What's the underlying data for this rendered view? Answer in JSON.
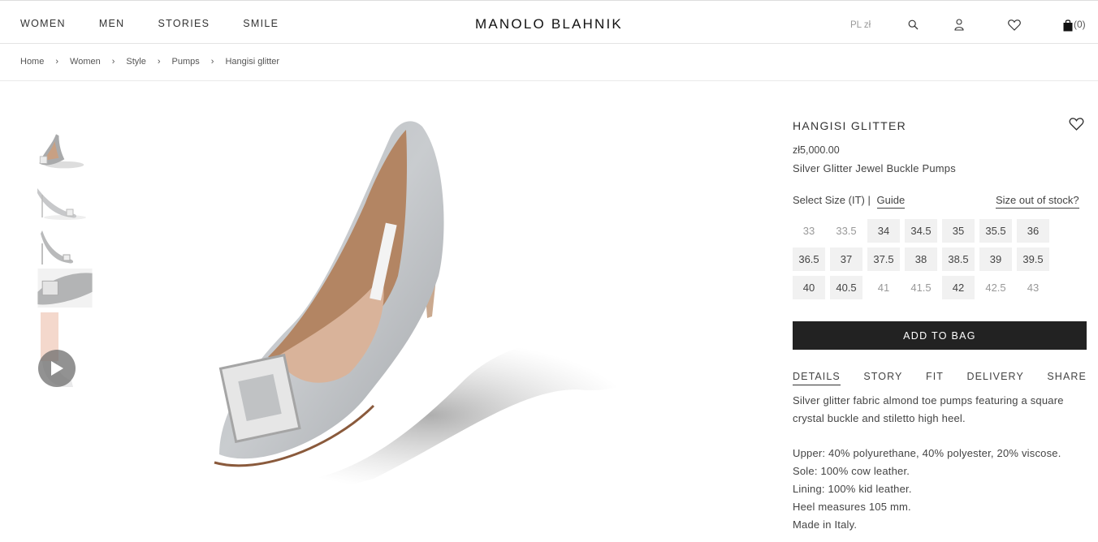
{
  "nav": {
    "items": [
      "WOMEN",
      "MEN",
      "STORIES",
      "SMILE"
    ]
  },
  "brand": "MANOLO BLAHNIK",
  "header": {
    "currency": "PL zł",
    "bag_count": "(0)"
  },
  "breadcrumb": [
    "Home",
    "Women",
    "Style",
    "Pumps",
    "Hangisi glitter"
  ],
  "product": {
    "title": "HANGISI GLITTER",
    "price": "zł5,000.00",
    "subtitle": "Silver Glitter Jewel Buckle Pumps",
    "select_size_label": "Select Size (IT)",
    "guide_label": "Guide",
    "out_of_stock_label": "Size out of stock?",
    "add_to_bag": "ADD TO BAG",
    "sizes": [
      {
        "label": "33",
        "available": false
      },
      {
        "label": "33.5",
        "available": false
      },
      {
        "label": "34",
        "available": true
      },
      {
        "label": "34.5",
        "available": true
      },
      {
        "label": "35",
        "available": true
      },
      {
        "label": "35.5",
        "available": true
      },
      {
        "label": "36",
        "available": true
      },
      {
        "label": "36.5",
        "available": true
      },
      {
        "label": "37",
        "available": true
      },
      {
        "label": "37.5",
        "available": true
      },
      {
        "label": "38",
        "available": true
      },
      {
        "label": "38.5",
        "available": true
      },
      {
        "label": "39",
        "available": true
      },
      {
        "label": "39.5",
        "available": true
      },
      {
        "label": "40",
        "available": true
      },
      {
        "label": "40.5",
        "available": true
      },
      {
        "label": "41",
        "available": false
      },
      {
        "label": "41.5",
        "available": false
      },
      {
        "label": "42",
        "available": true
      },
      {
        "label": "42.5",
        "available": false
      },
      {
        "label": "43",
        "available": false
      }
    ],
    "tabs": [
      "DETAILS",
      "STORY",
      "FIT",
      "DELIVERY",
      "SHARE"
    ],
    "description": "Silver glitter fabric almond toe pumps featuring a square crystal buckle and stiletto high heel.",
    "specs": [
      "Upper: 40% polyurethane, 40% polyester, 20% viscose.",
      "Sole: 100% cow leather.",
      "Lining: 100% kid leather.",
      "Heel measures 105 mm.",
      "Made in Italy."
    ]
  },
  "icons": {
    "search": "search-icon",
    "account": "user-icon",
    "wishlist": "heart-icon",
    "bag": "shopping-bag-icon",
    "breadcrumb_sep": "chevron-right-icon",
    "play": "play-icon"
  },
  "colors": {
    "button": "#222222",
    "size_available_bg": "#f1f1f1",
    "size_unavailable_text": "#999999"
  }
}
